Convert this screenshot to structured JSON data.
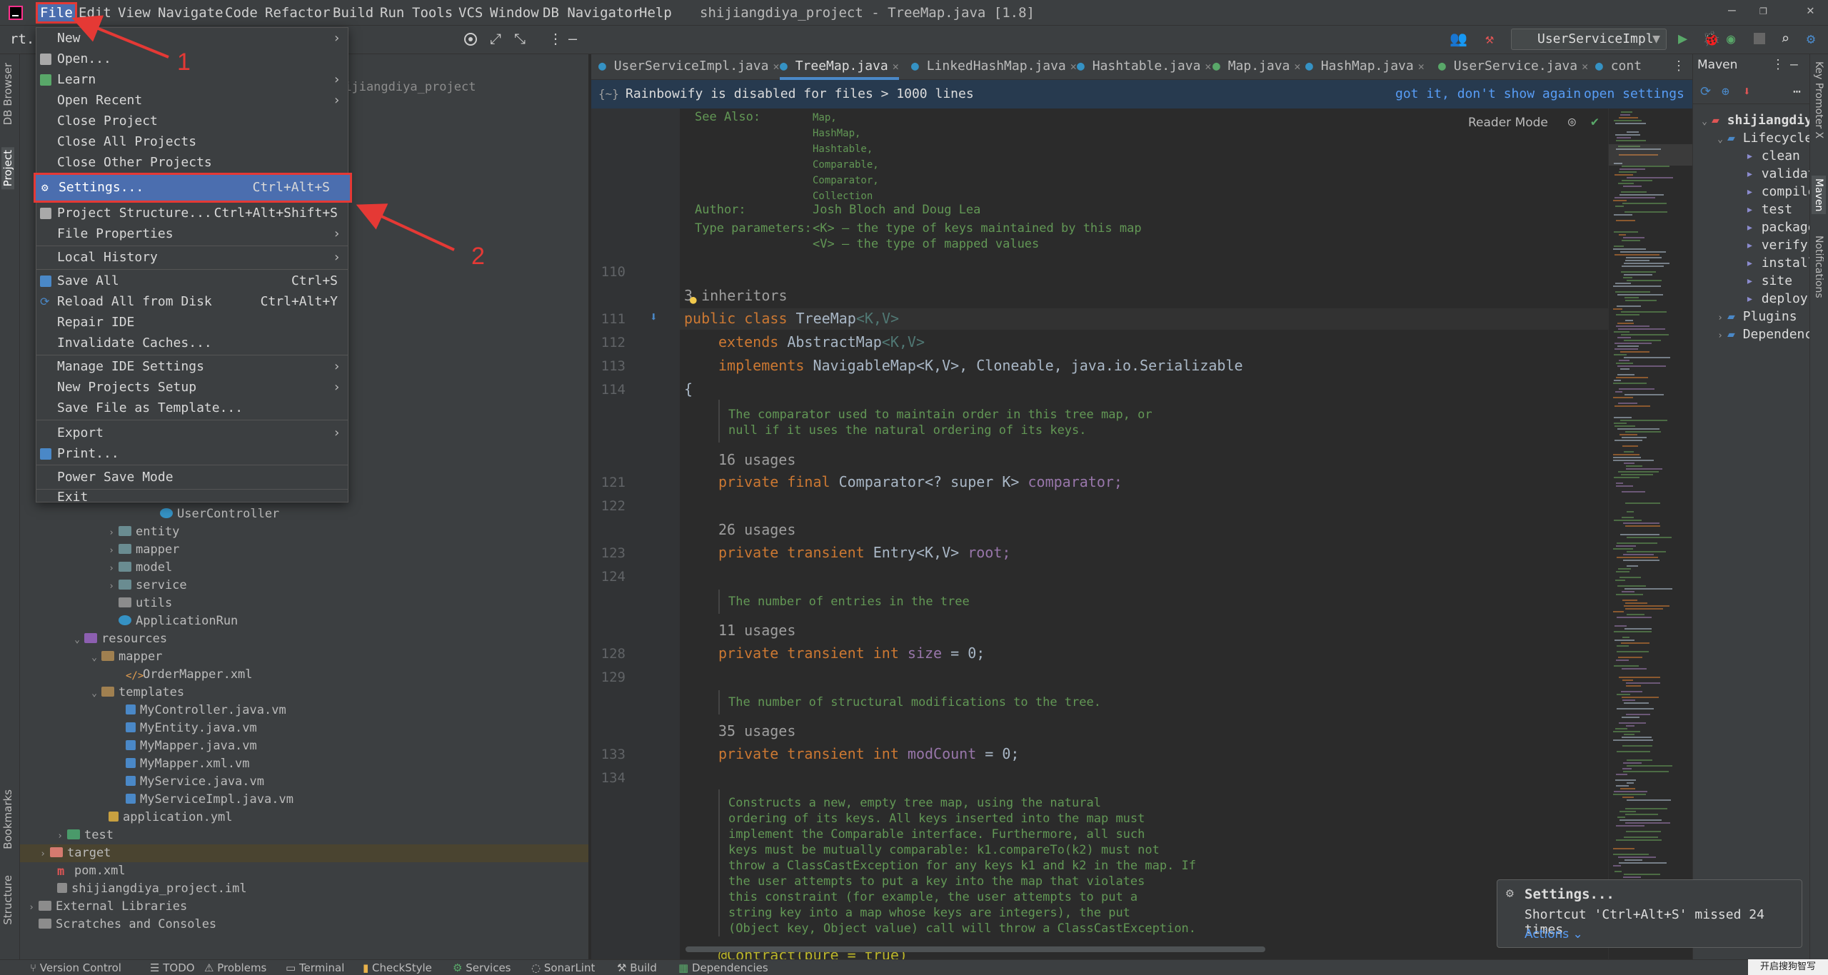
{
  "menubar": {
    "items": [
      "File",
      "Edit",
      "View",
      "Navigate",
      "Code",
      "Refactor",
      "Build",
      "Run",
      "Tools",
      "VCS",
      "Window",
      "DB Navigator",
      "Help"
    ],
    "window_title": "shijiangdiya_project - TreeMap.java [1.8]",
    "window_controls": [
      "—",
      "❐",
      "✕"
    ]
  },
  "toolbar": {
    "breadcrumb_fragment": "rt.",
    "run_config": "UserServiceImpl"
  },
  "file_menu": {
    "items": {
      "new": "New",
      "open": "Open...",
      "learn": "Learn",
      "open_recent": "Open Recent",
      "close_project": "Close Project",
      "close_all_projects": "Close All Projects",
      "close_other_projects": "Close Other Projects",
      "settings": "Settings...",
      "settings_shortcut": "Ctrl+Alt+S",
      "project_structure": "Project Structure...",
      "project_structure_shortcut": "Ctrl+Alt+Shift+S",
      "file_properties": "File Properties",
      "local_history": "Local History",
      "save_all": "Save All",
      "save_all_shortcut": "Ctrl+S",
      "reload_all": "Reload All from Disk",
      "reload_all_shortcut": "Ctrl+Alt+Y",
      "repair_ide": "Repair IDE",
      "invalidate_caches": "Invalidate Caches...",
      "manage_ide_settings": "Manage IDE Settings",
      "new_projects_setup": "New Projects Setup",
      "save_file_as_template": "Save File as Template...",
      "export": "Export",
      "print": "Print...",
      "power_save_mode": "Power Save Mode",
      "exit": "Exit"
    }
  },
  "annotations": {
    "label_1": "1",
    "label_2": "2",
    "color": "#e53935"
  },
  "project_tree": {
    "project_root_fragment": "hijiangdiya_project",
    "rows": {
      "user_controller": "UserController",
      "entity": "entity",
      "mapper": "mapper",
      "model": "model",
      "service": "service",
      "utils": "utils",
      "application_run": "ApplicationRun",
      "resources": "resources",
      "res_mapper": "mapper",
      "order_mapper_xml": "OrderMapper.xml",
      "templates": "templates",
      "my_controller_vm": "MyController.java.vm",
      "my_entity_vm": "MyEntity.java.vm",
      "my_mapper_vm": "MyMapper.java.vm",
      "my_mapper_xml_vm": "MyMapper.xml.vm",
      "my_service_vm": "MyService.java.vm",
      "my_service_impl_vm": "MyServiceImpl.java.vm",
      "application_yml": "application.yml",
      "test": "test",
      "target": "target",
      "pom_xml": "pom.xml",
      "iml": "shijiangdiya_project.iml",
      "external_libraries": "External Libraries",
      "scratches": "Scratches and Consoles"
    }
  },
  "left_stripe": {
    "db_browser": "DB Browser",
    "project": "Project",
    "bookmarks": "Bookmarks",
    "structure": "Structure"
  },
  "right_stripe": {
    "key_promoter": "Key Promoter X",
    "maven": "Maven",
    "notifications": "Notifications"
  },
  "editor_tabs": [
    {
      "label": "UserServiceImpl.java"
    },
    {
      "label": "TreeMap.java"
    },
    {
      "label": "LinkedHashMap.java"
    },
    {
      "label": "Hashtable.java"
    },
    {
      "label": "Map.java"
    },
    {
      "label": "HashMap.java"
    },
    {
      "label": "UserService.java"
    },
    {
      "label": "cont"
    }
  ],
  "notice": {
    "text": "Rainbowify is disabled for files > 1000 lines",
    "dismiss": "got it, don't show again",
    "settings": "open settings"
  },
  "editor": {
    "reader_mode": "Reader Mode",
    "see_also_label": "See Also:",
    "see_also": [
      "Map,",
      "HashMap,",
      "Hashtable,",
      "Comparable,",
      "Comparator,",
      "Collection"
    ],
    "author_label": "Author:",
    "author": "Josh Bloch and Doug Lea",
    "type_params_label": "Type parameters:",
    "type_param_k": "<K> – the type of keys maintained by this map",
    "type_param_v": "<V> – the type of mapped values",
    "inheritors": "3 inheritors",
    "line_numbers": {
      "l110": "110",
      "l111": "111",
      "l112": "112",
      "l113": "113",
      "l114": "114",
      "l121": "121",
      "l122": "122",
      "l123": "123",
      "l124": "124",
      "l128": "128",
      "l129": "129",
      "l133": "133",
      "l134": "134"
    },
    "code": {
      "class_kw": "public class",
      "class_name": "TreeMap",
      "type_params": "<K,V>",
      "extends_kw": "extends",
      "extends_type": "AbstractMap",
      "implements_kw": "implements",
      "implements_rest": "NavigableMap<K,V>, Cloneable, java.io.Serializable",
      "brace": "{",
      "comparator_kw": "private final",
      "comparator_rest": "Comparator<? super K>",
      "comparator_field": "comparator;",
      "root_kw": "private transient",
      "root_type": "Entry<K,V>",
      "root_field": "root;",
      "size_kw": "private transient int",
      "size_field": "size",
      "modcount_kw": "private transient int",
      "modcount_field": "modCount",
      "eq_zero": "= 0;",
      "ctor_fragment": "@Contract(pure = true)"
    },
    "usages": {
      "u16": "16 usages",
      "u26": "26 usages",
      "u11": "11 usages",
      "u35": "35 usages"
    },
    "docs": {
      "comparator": "The comparator used to maintain order in this tree map, or\nnull if it uses the natural ordering of its keys.",
      "size": "The number of entries in the tree",
      "modcount": "The number of structural modifications to the tree.",
      "ctor": "Constructs a new, empty tree map, using the natural\nordering of its keys. All keys inserted into the map must\nimplement the Comparable interface. Furthermore, all such\nkeys must be mutually comparable: k1.compareTo(k2) must not\nthrow a ClassCastException for any keys k1 and k2 in the map. If\nthe user attempts to put a key into the map that violates\nthis constraint (for example, the user attempts to put a\nstring key into a map whose keys are integers), the put\n(Object key, Object value) call will throw a ClassCastException."
    }
  },
  "maven": {
    "title": "Maven",
    "root": "shijiangdiy",
    "lifecycle": "Lifecycle",
    "goals": [
      "clean",
      "validat",
      "compile",
      "test",
      "package",
      "verify",
      "install",
      "site",
      "deploy"
    ],
    "plugins": "Plugins",
    "dependencies": "Dependenc"
  },
  "statusbar": {
    "items": [
      "Version Control",
      "TODO",
      "Problems",
      "Terminal",
      "CheckStyle",
      "Services",
      "SonarLint",
      "Build",
      "Dependencies"
    ]
  },
  "toast": {
    "title": "Settings...",
    "message": "Shortcut 'Ctrl+Alt+S' missed 24 times",
    "action": "Actions"
  },
  "ime": {
    "label": "开启搜狗智写"
  }
}
